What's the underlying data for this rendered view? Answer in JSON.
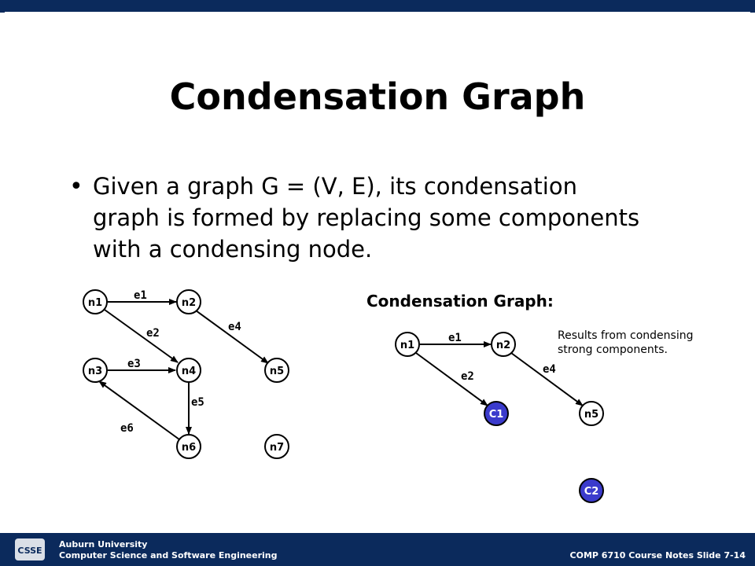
{
  "slide": {
    "title": "Condensation Graph",
    "bullet_line1": "Given a graph G = (V, E), its condensation",
    "bullet_line2": "graph is formed by replacing some components",
    "bullet_line3": "with a condensing node.",
    "condensation_heading": "Condensation Graph:",
    "note_line1": "Results from condensing",
    "note_line2": "strong components."
  },
  "original_graph": {
    "nodes": [
      "n1",
      "n2",
      "n3",
      "n4",
      "n5",
      "n6",
      "n7"
    ],
    "edges": [
      {
        "label": "e1",
        "from": "n1",
        "to": "n2"
      },
      {
        "label": "e2",
        "from": "n1",
        "to": "n4"
      },
      {
        "label": "e3",
        "from": "n3",
        "to": "n4"
      },
      {
        "label": "e4",
        "from": "n2",
        "to": "n5"
      },
      {
        "label": "e5",
        "from": "n4",
        "to": "n6"
      },
      {
        "label": "e6",
        "from": "n6",
        "to": "n3"
      }
    ]
  },
  "condensed_graph": {
    "nodes": [
      "n1",
      "n2",
      "C1",
      "n5",
      "C2"
    ],
    "edges": [
      {
        "label": "e1",
        "from": "n1",
        "to": "n2"
      },
      {
        "label": "e2",
        "from": "n1",
        "to": "C1"
      },
      {
        "label": "e4",
        "from": "n2",
        "to": "n5"
      }
    ]
  },
  "footer": {
    "org_line1": "Auburn University",
    "org_line2": "Computer Science and Software Engineering",
    "slide_ref": "COMP 6710 Course Notes Slide 7-14",
    "logo_text": "CSSE"
  },
  "colors": {
    "navy": "#0b2a5c",
    "condensed_node_fill": "#3b3bcc"
  }
}
